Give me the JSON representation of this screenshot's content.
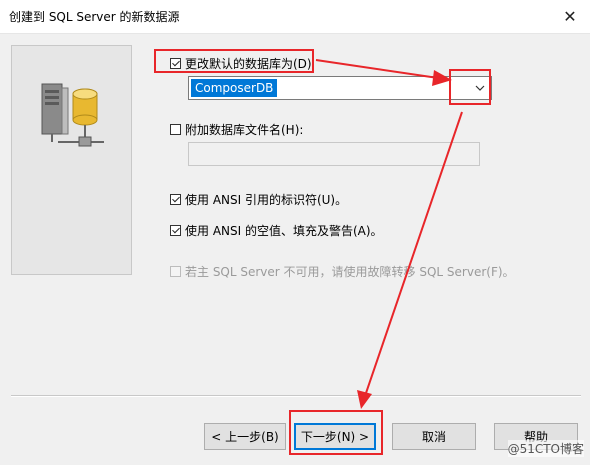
{
  "window": {
    "title": "创建到 SQL Server 的新数据源",
    "close_glyph": "✕"
  },
  "options": {
    "change_default_db": {
      "label": "更改默认的数据库为(D)",
      "checked": true
    },
    "database_select": {
      "value": "ComposerDB"
    },
    "attach_db_file": {
      "label": "附加数据库文件名(H):",
      "checked": false,
      "value": ""
    },
    "ansi_quoted": {
      "label": "使用 ANSI 引用的标识符(U)。",
      "checked": true
    },
    "ansi_nulls": {
      "label": "使用 ANSI 的空值、填充及警告(A)。",
      "checked": true
    },
    "failover": {
      "label": "若主 SQL Server 不可用，请使用故障转移 SQL Server(F)。",
      "checked": false,
      "disabled": true
    }
  },
  "buttons": {
    "back": "< 上一步(B)",
    "next": "下一步(N) >",
    "cancel": "取消",
    "help": "帮助"
  },
  "watermark": "@51CTO博客",
  "colors": {
    "highlight": "#e8262a",
    "selection": "#0078d7"
  }
}
